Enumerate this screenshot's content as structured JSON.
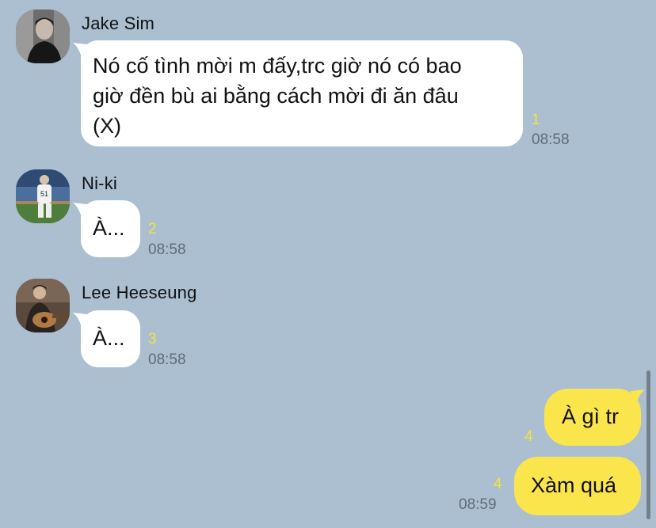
{
  "messages": [
    {
      "sender": "Jake Sim",
      "text": "Nó cố tình mời m đấy,trc giờ nó có bao\ngiờ đền bù ai bằng cách mời đi ăn đâu\n(X)",
      "read_count": "1",
      "time": "08:58",
      "avatar_icon": "person-portrait-dark"
    },
    {
      "sender": "Ni-ki",
      "text": "À...",
      "read_count": "2",
      "time": "08:58",
      "avatar_icon": "baseball-player-on-field"
    },
    {
      "sender": "Lee Heeseung",
      "text": "À...",
      "read_count": "3",
      "time": "08:58",
      "avatar_icon": "person-with-guitar"
    }
  ],
  "outgoing": [
    {
      "text": "À gì tr",
      "read_count": "4"
    },
    {
      "text": "Xàm quá",
      "read_count": "4",
      "time": "08:59"
    }
  ],
  "colors": {
    "background": "#abbfd1",
    "incoming_bubble": "#ffffff",
    "outgoing_bubble": "#fbe54d",
    "read_count": "#f3e33f",
    "timestamp": "#5f6d79"
  }
}
